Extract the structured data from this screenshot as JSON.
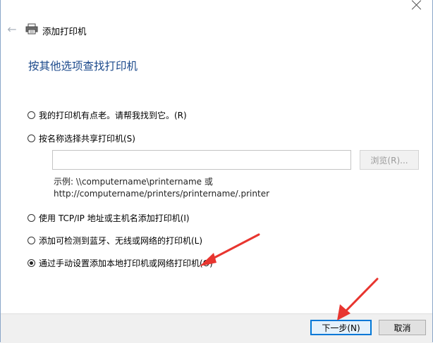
{
  "window": {
    "title": "添加打印机"
  },
  "nav": {
    "back_icon": "back-arrow-icon",
    "title_icon": "printer-icon"
  },
  "heading": "按其他选项查找打印机",
  "options": [
    {
      "label": "我的打印机有点老。请帮我找到它。(R)",
      "selected": false
    },
    {
      "label": "按名称选择共享打印机(S)",
      "selected": false
    },
    {
      "label": "使用 TCP/IP 地址或主机名添加打印机(I)",
      "selected": false
    },
    {
      "label": "添加可检测到蓝牙、无线或网络的打印机(L)",
      "selected": false
    },
    {
      "label": "通过手动设置添加本地打印机或网络打印机(O)",
      "selected": true
    }
  ],
  "share": {
    "input_value": "",
    "browse_label": "浏览(R)...",
    "example_line1": "示例: \\\\computername\\printername 或",
    "example_line2": "http://computername/printers/printername/.printer"
  },
  "footer": {
    "next_label": "下一步(N)",
    "cancel_label": "取消"
  },
  "colors": {
    "heading": "#1c4a8c",
    "accent": "#0078d7",
    "annotation": "#e8352f"
  }
}
